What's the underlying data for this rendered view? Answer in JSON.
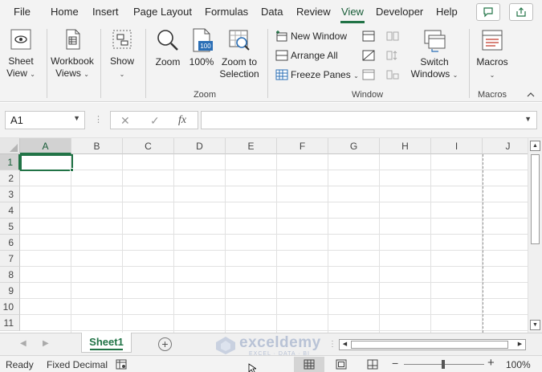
{
  "menu": {
    "tabs": [
      "File",
      "Home",
      "Insert",
      "Page Layout",
      "Formulas",
      "Data",
      "Review",
      "View",
      "Developer",
      "Help"
    ],
    "active": "View"
  },
  "ribbon": {
    "sheet_view": {
      "line1": "Sheet",
      "line2": "View",
      "icon": "eye-icon"
    },
    "workbook_views": {
      "line1": "Workbook",
      "line2": "Views",
      "icon": "workbook-views-icon"
    },
    "show": {
      "label": "Show",
      "icon": "show-icon"
    },
    "zoom": {
      "label": "Zoom",
      "icon": "magnifier-icon"
    },
    "zoom100": {
      "label": "100%",
      "icon_text": "100",
      "icon": "zoom-100-icon"
    },
    "zoom_selection": {
      "line1": "Zoom to",
      "line2": "Selection",
      "icon": "zoom-selection-icon"
    },
    "zoom_group": "Zoom",
    "new_window": "New Window",
    "arrange_all": "Arrange All",
    "freeze_panes": "Freeze Panes",
    "switch_windows": {
      "line1": "Switch",
      "line2": "Windows",
      "icon": "switch-windows-icon"
    },
    "window_group": "Window",
    "macros": {
      "label": "Macros",
      "icon": "macros-icon"
    },
    "macros_group": "Macros"
  },
  "formula_bar": {
    "name_box": "A1",
    "cancel_icon": "✕",
    "enter_icon": "✓",
    "fx": "fx",
    "value": ""
  },
  "grid": {
    "columns": [
      "A",
      "B",
      "C",
      "D",
      "E",
      "F",
      "G",
      "H",
      "I",
      "J"
    ],
    "rows": [
      "1",
      "2",
      "3",
      "4",
      "5",
      "6",
      "7",
      "8",
      "9",
      "10",
      "11"
    ],
    "selected_column": "A",
    "selected_row": "1"
  },
  "sheets": {
    "tabs": [
      "Sheet1"
    ],
    "active": "Sheet1",
    "add_label": "+"
  },
  "watermark": {
    "name": "exceldemy",
    "tagline": "EXCEL · DATA · BI"
  },
  "status": {
    "ready": "Ready",
    "mode": "Fixed Decimal",
    "zoom_minus": "−",
    "zoom_plus": "+",
    "zoom": "100%"
  },
  "colors": {
    "accent": "#217346",
    "active_text": "#185c37",
    "ribbon_bg": "#f3f3f3"
  }
}
